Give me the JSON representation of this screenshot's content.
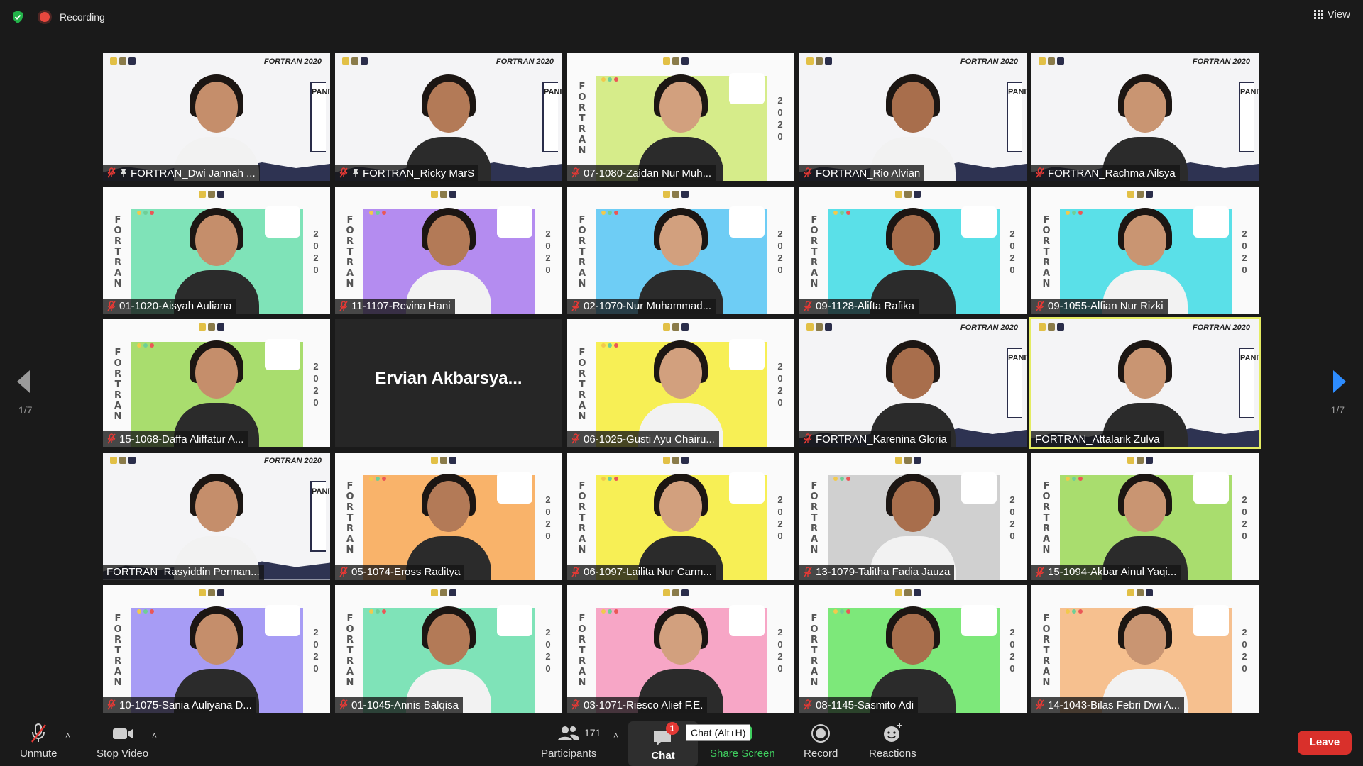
{
  "topbar": {
    "recording_label": "Recording",
    "view_label": "View"
  },
  "pagination": {
    "left_count": "1/7",
    "right_count": "1/7"
  },
  "banner": {
    "fortran_vertical": "FORTRAN",
    "year_vertical": "2020",
    "fortran_title": "FORTRAN 2020",
    "panitia": "PANITIA"
  },
  "tiles": [
    {
      "name": "FORTRAN_Dwi Jannah ...",
      "muted": true,
      "pinned": true,
      "style": "panitia",
      "bg": "#ffffff"
    },
    {
      "name": "FORTRAN_Ricky MarS",
      "muted": true,
      "pinned": true,
      "style": "panitia",
      "bg": "#ffffff"
    },
    {
      "name": "07-1080-Zaidan Nur Muh...",
      "muted": true,
      "pinned": false,
      "style": "fortran",
      "bg": "#d6ec8a"
    },
    {
      "name": "FORTRAN_Rio Alvian",
      "muted": true,
      "pinned": false,
      "style": "panitia",
      "bg": "#ffffff"
    },
    {
      "name": "FORTRAN_Rachma Ailsya",
      "muted": true,
      "pinned": false,
      "style": "panitia",
      "bg": "#ffffff"
    },
    {
      "name": "01-1020-Aisyah Auliana",
      "muted": true,
      "pinned": false,
      "style": "fortran",
      "bg": "#7fe3b8"
    },
    {
      "name": "11-1107-Revina Hani",
      "muted": true,
      "pinned": false,
      "style": "fortran",
      "bg": "#b48cf0"
    },
    {
      "name": "02-1070-Nur Muhammad...",
      "muted": true,
      "pinned": false,
      "style": "fortran",
      "bg": "#6ecdf5"
    },
    {
      "name": "09-1128-Alifta Rafika",
      "muted": true,
      "pinned": false,
      "style": "fortran",
      "bg": "#5ae0e8"
    },
    {
      "name": "09-1055-Alfian Nur Rizki",
      "muted": true,
      "pinned": false,
      "style": "fortran",
      "bg": "#5ae0e8"
    },
    {
      "name": "15-1068-Daffa Aliffatur A...",
      "muted": true,
      "pinned": false,
      "style": "fortran",
      "bg": "#a9dd6e"
    },
    {
      "name": "Ervian  Akbarsya...",
      "muted": true,
      "pinned": false,
      "style": "dark",
      "bg": "#262626"
    },
    {
      "name": "06-1025-Gusti Ayu Chairu...",
      "muted": true,
      "pinned": false,
      "style": "fortran",
      "bg": "#f7ef55"
    },
    {
      "name": "FORTRAN_Karenina Gloria",
      "muted": true,
      "pinned": false,
      "style": "panitia",
      "bg": "#ffffff"
    },
    {
      "name": "FORTRAN_Attalarik Zulva",
      "muted": false,
      "pinned": false,
      "style": "panitia",
      "bg": "#ffffff",
      "active": true
    },
    {
      "name": "FORTRAN_Rasyiddin Perman...",
      "muted": false,
      "pinned": false,
      "style": "panitia",
      "bg": "#ffffff"
    },
    {
      "name": "05-1074-Eross Raditya",
      "muted": true,
      "pinned": false,
      "style": "fortran",
      "bg": "#f9b36a"
    },
    {
      "name": "06-1097-Lailita Nur Carm...",
      "muted": true,
      "pinned": false,
      "style": "fortran",
      "bg": "#f7ef55"
    },
    {
      "name": "13-1079-Talitha Fadia Jauza",
      "muted": true,
      "pinned": false,
      "style": "fortran",
      "bg": "#d0d0d0"
    },
    {
      "name": "15-1094-Akbar Ainul Yaqi...",
      "muted": true,
      "pinned": false,
      "style": "fortran",
      "bg": "#a9dd6e"
    },
    {
      "name": "10-1075-Sania Auliyana D...",
      "muted": true,
      "pinned": false,
      "style": "fortran",
      "bg": "#a79cf5"
    },
    {
      "name": "01-1045-Annis Balqisa",
      "muted": true,
      "pinned": false,
      "style": "fortran",
      "bg": "#7fe3b8"
    },
    {
      "name": "03-1071-Riesco Alief F.E.",
      "muted": true,
      "pinned": false,
      "style": "fortran",
      "bg": "#f7a6c6"
    },
    {
      "name": "08-1145-Sasmito Adi",
      "muted": true,
      "pinned": false,
      "style": "fortran",
      "bg": "#7de87a"
    },
    {
      "name": "14-1043-Bilas Febri Dwi A...",
      "muted": true,
      "pinned": false,
      "style": "fortran",
      "bg": "#f6c08f"
    }
  ],
  "toolbar": {
    "unmute_label": "Unmute",
    "stop_video_label": "Stop Video",
    "participants_label": "Participants",
    "participants_count": "171",
    "chat_label": "Chat",
    "chat_badge": "1",
    "chat_tooltip": "Chat (Alt+H)",
    "share_screen_label": "Share Screen",
    "record_label": "Record",
    "reactions_label": "Reactions",
    "leave_label": "Leave"
  },
  "colors": {
    "background": "#1a1a1a",
    "active_speaker": "#e4ec62",
    "share_green": "#3fcf5f",
    "leave_red": "#d9302b",
    "recording_red": "#e8473e",
    "paging_arrow_left": "#9a9a9a",
    "paging_arrow_right": "#2d8cff"
  },
  "icons": [
    "shield-icon",
    "recording-icon",
    "view-grid-icon",
    "arrow-left-icon",
    "arrow-right-icon",
    "mic-off-icon",
    "pin-icon",
    "video-icon",
    "participants-icon",
    "chat-icon",
    "share-screen-icon",
    "record-icon",
    "reactions-icon",
    "caret-up-icon"
  ]
}
